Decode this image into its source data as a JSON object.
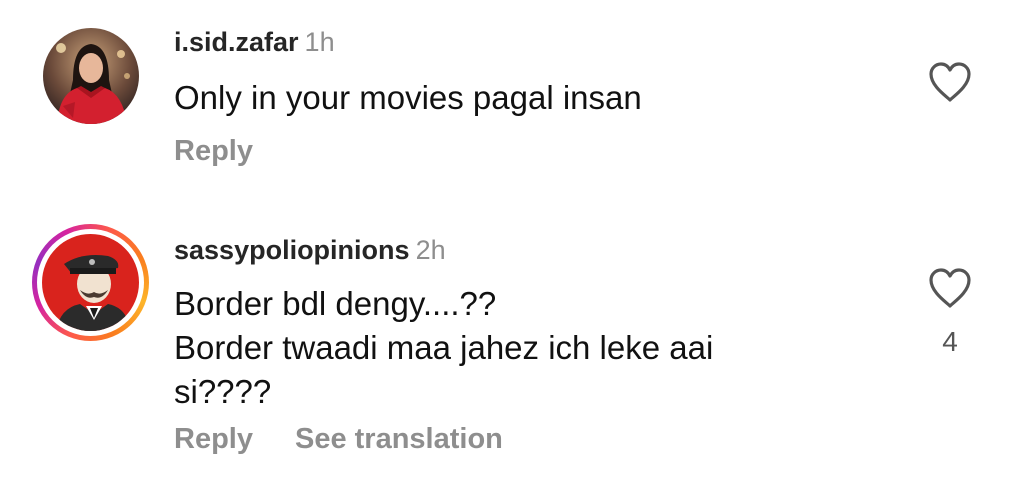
{
  "comments": [
    {
      "username": "i.sid.zafar",
      "time": "1h",
      "lines": [
        "Only in your movies pagal insan"
      ],
      "actions": {
        "reply": "Reply"
      },
      "like_count": "",
      "has_story_ring": false
    },
    {
      "username": "sassypoliopinions",
      "time": "2h",
      "lines": [
        "Border bdl dengy....??",
        "Border twaadi maa jahez ich leke aai",
        "si????"
      ],
      "actions": {
        "reply": "Reply",
        "see_translation": "See translation"
      },
      "like_count": "4",
      "has_story_ring": true
    }
  ],
  "icons": {
    "like": "heart-outline-icon"
  },
  "colors": {
    "username": "#262626",
    "meta": "#8e8e8e",
    "text": "#111111",
    "story_ring_start": "#fdb52a",
    "story_ring_end": "#d6249f"
  }
}
